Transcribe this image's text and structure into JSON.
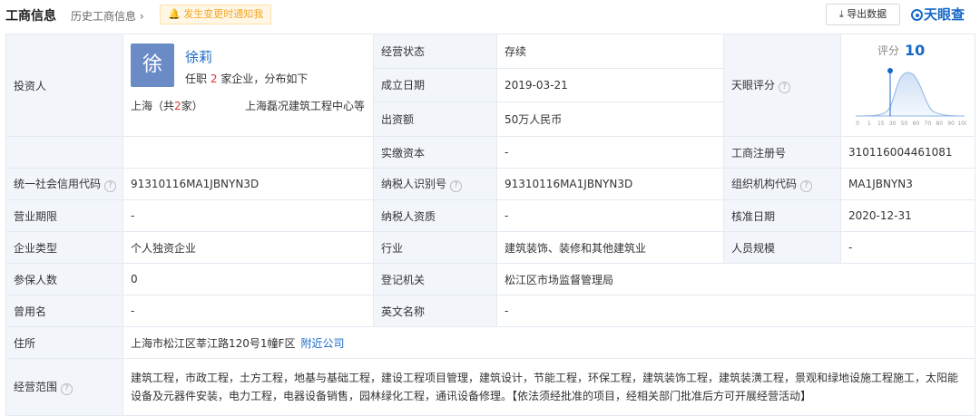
{
  "header": {
    "title": "工商信息",
    "history_link": "历史工商信息",
    "history_arrow": "›",
    "notify_label": "发生变更时通知我",
    "export_label": "导出数据",
    "logo": "天眼查"
  },
  "investor": {
    "label": "投资人",
    "avatar_char": "徐",
    "name": "徐莉",
    "sub_prefix": "任职",
    "sub_count": "2",
    "sub_suffix": "家企业，分布如下",
    "city_prefix": "上海（共",
    "city_count": "2",
    "city_suffix": "家）",
    "company": "上海磊况建筑工程中心等"
  },
  "fields": {
    "status_label": "经营状态",
    "status": "存续",
    "founded_label": "成立日期",
    "founded": "2019-03-21",
    "capital_label": "出资额",
    "capital": "50万人民币",
    "paid_label": "实缴资本",
    "paid": "-",
    "score_label": "天眼评分",
    "reg_no_label": "工商注册号",
    "reg_no": "310116004461081",
    "credit_label": "统一社会信用代码",
    "credit": "91310116MA1JBNYN3D",
    "taxid_label": "纳税人识别号",
    "taxid": "91310116MA1JBNYN3D",
    "org_label": "组织机构代码",
    "org": "MA1JBNYN3",
    "term_label": "营业期限",
    "term": "-",
    "tax_qual_label": "纳税人资质",
    "tax_qual": "-",
    "approve_label": "核准日期",
    "approve": "2020-12-31",
    "type_label": "企业类型",
    "type": "个人独资企业",
    "industry_label": "行业",
    "industry": "建筑装饰、装修和其他建筑业",
    "staff_label": "人员规模",
    "staff": "-",
    "insured_label": "参保人数",
    "insured": "0",
    "authority_label": "登记机关",
    "authority": "松江区市场监督管理局",
    "former_label": "曾用名",
    "former": "-",
    "en_label": "英文名称",
    "en": "-",
    "address_label": "住所",
    "address": "上海市松江区莘江路120号1幢F区",
    "nearby_link": "附近公司",
    "scope_label": "经营范围",
    "scope": "建筑工程，市政工程，土方工程，地基与基础工程，建设工程项目管理，建筑设计，节能工程，环保工程，建筑装饰工程，建筑装潢工程，景观和绿地设施工程施工，太阳能设备及元器件安装，电力工程，电器设备销售，园林绿化工程，通讯设备修理。【依法须经批准的项目，经相关部门批准后方可开展经营活动】"
  },
  "score": {
    "label": "评分",
    "value": 10,
    "ticks": [
      "0",
      "1",
      "15",
      "30",
      "50",
      "60",
      "70",
      "80",
      "90",
      "100"
    ]
  },
  "colors": {
    "accent": "#1769c9",
    "highlight": "#e03636",
    "label_bg": "#f2f6fb",
    "notify": "#f5a623"
  }
}
